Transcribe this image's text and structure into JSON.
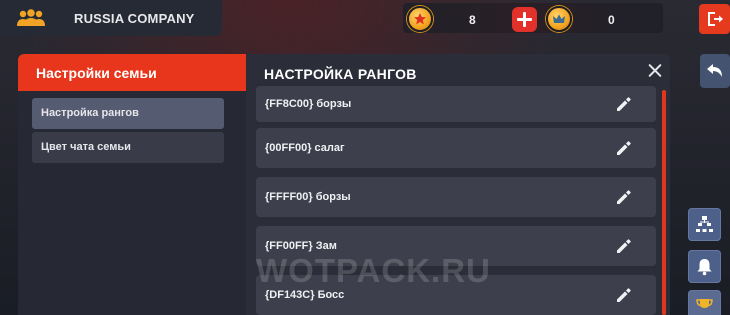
{
  "topbar": {
    "company_name": "RUSSIA COMPANY",
    "family_icon": "family-group-icon",
    "currency": [
      {
        "icon": "star-coin-icon",
        "amount": "8"
      },
      {
        "icon": "crown-coin-icon",
        "amount": "0"
      }
    ],
    "plus_icon": "plus-icon",
    "exit_icon": "exit-door-icon"
  },
  "sidebar": {
    "title": "Настройки семьи",
    "items": [
      {
        "label": "Настройка рангов",
        "active": true
      },
      {
        "label": "Цвет чата семьи",
        "active": false
      }
    ]
  },
  "panel": {
    "title": "НАСТРОЙКА РАНГОВ",
    "close_icon": "close-icon",
    "ranks": [
      {
        "name": "{FF8C00} борзы"
      },
      {
        "name": "{00FF00} салаг"
      },
      {
        "name": "{FFFF00} борзы"
      },
      {
        "name": "{FF00FF} Зам"
      },
      {
        "name": "{DF143C} Босс"
      }
    ]
  },
  "right_tools": {
    "back_icon": "back-arrow-icon",
    "tools": [
      "hierarchy-icon",
      "bell-icon",
      "trophy-icon"
    ]
  },
  "watermark": "WOTPACK.RU",
  "colors": {
    "accent": "#e8361c",
    "panel_bg": "#2b2e39",
    "row_bg": "#3d404c",
    "tool_bg": "#4d6089",
    "coin": "#f3a31f"
  }
}
